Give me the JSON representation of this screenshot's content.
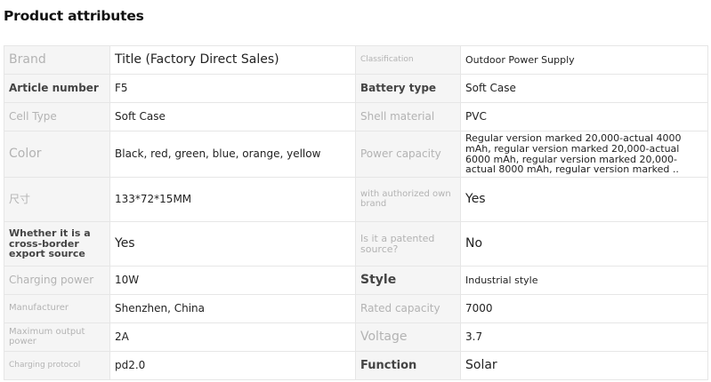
{
  "heading": "Product attributes",
  "rows": [
    {
      "l1": "Brand",
      "v1": "Title (Factory Direct Sales)",
      "l2": "Classification",
      "v2": "Outdoor Power Supply"
    },
    {
      "l1": "Article number",
      "v1": "F5",
      "l2": "Battery type",
      "v2": "Soft Case"
    },
    {
      "l1": "Cell Type",
      "v1": "Soft Case",
      "l2": "Shell material",
      "v2": "PVC"
    },
    {
      "l1": "Color",
      "v1": "Black, red, green, blue, orange, yellow",
      "l2": "Power capacity",
      "v2": "Regular version marked 20,000-actual 4000 mAh, regular version marked 20,000-actual 6000 mAh, regular version marked 20,000-actual 8000 mAh, regular version marked .."
    },
    {
      "l1": "尺寸",
      "v1": "133*72*15MM",
      "l2": "with authorized own brand",
      "v2": "Yes"
    },
    {
      "l1": "Whether it is a cross-border export source",
      "v1": "Yes",
      "l2": "Is it a patented source?",
      "v2": "No"
    },
    {
      "l1": "Charging power",
      "v1": "10W",
      "l2": "Style",
      "v2": "Industrial style"
    },
    {
      "l1": "Manufacturer",
      "v1": "Shenzhen, China",
      "l2": "Rated capacity",
      "v2": "7000"
    },
    {
      "l1": "Maximum output power",
      "v1": "2A",
      "l2": "Voltage",
      "v2": "3.7"
    },
    {
      "l1": "Charging protocol",
      "v1": "pd2.0",
      "l2": "Function",
      "v2": "Solar"
    }
  ]
}
